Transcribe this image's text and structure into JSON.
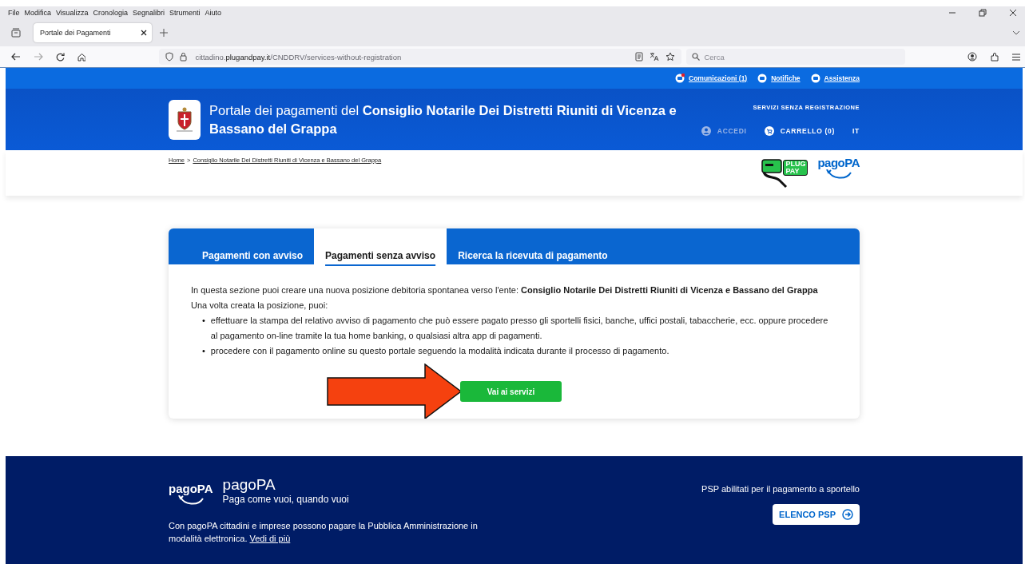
{
  "browser": {
    "menu": [
      "File",
      "Modifica",
      "Visualizza",
      "Cronologia",
      "Segnalibri",
      "Strumenti",
      "Aiuto"
    ],
    "tab_title": "Portale dei Pagamenti",
    "url": {
      "subdomain": "cittadino.",
      "domain": "plugandpay.it",
      "path": "/CNDDRV/services-without-registration"
    },
    "search": {
      "placeholder": "Cerca"
    }
  },
  "utility_links": [
    {
      "label": "Comunicazioni (1)",
      "dot": true
    },
    {
      "label": "Notifiche",
      "dot": false
    },
    {
      "label": "Assistenza",
      "dot": false
    }
  ],
  "header": {
    "title": "Portale dei pagamenti del **Consiglio Notarile Dei Distretti Riuniti di Vicenza e Bassano del Grappa**",
    "services_link": "SERVIZI SENZA REGISTRAZIONE",
    "login": {
      "label": "ACCEDI",
      "disabled": true
    },
    "cart": {
      "label": "CARRELLO (0)",
      "disabled": false
    },
    "language": "IT"
  },
  "breadcrumb": {
    "items": [
      "Home",
      "Consiglio Notarile Dei Distretti Riuniti di Vicenza e Bassano del Grappa"
    ],
    "separator": ">"
  },
  "logos": {
    "plugpay": [
      "PLUG",
      "PAY"
    ],
    "pagopa": "pagoPA"
  },
  "tabs": [
    {
      "label": "Pagamenti con avviso",
      "selected": false
    },
    {
      "label": "Pagamenti senza avviso",
      "selected": true
    },
    {
      "label": "Ricerca la ricevuta di pagamento",
      "selected": false
    }
  ],
  "content": {
    "intro": "In questa sezione puoi creare una nuova posizione debitoria spontanea verso l'ente: **Consiglio Notarile Dei Distretti Riuniti di Vicenza e Bassano del Grappa**",
    "lead": "Una volta creata la posizione, puoi:",
    "bullet_marker": "•",
    "bullets": [
      "effettuare la stampa del relativo avviso di pagamento che può essere pagato presso gli sportelli fisici, banche, uffici postali, tabaccherie, ecc. oppure procedere al pagamento on-line tramite la tua home banking, o qualsiasi altra app di pagamenti.",
      "procedere con il pagamento online su questo portale seguendo la modalità indicata durante il processo di pagamento."
    ],
    "button": "Vai ai servizi"
  },
  "footer": {
    "logo": "pagoPA",
    "brand": "pagoPA",
    "tagline": "Paga come vuoi, quando vuoi",
    "description": "Con pagoPA cittadini e imprese possono pagare la Pubblica Amministrazione in modalità elettronica.",
    "more_link": "Vedi di più",
    "psp_text": "PSP abilitati per il pagamento a sportello",
    "psp_button": "ELENCO PSP"
  }
}
